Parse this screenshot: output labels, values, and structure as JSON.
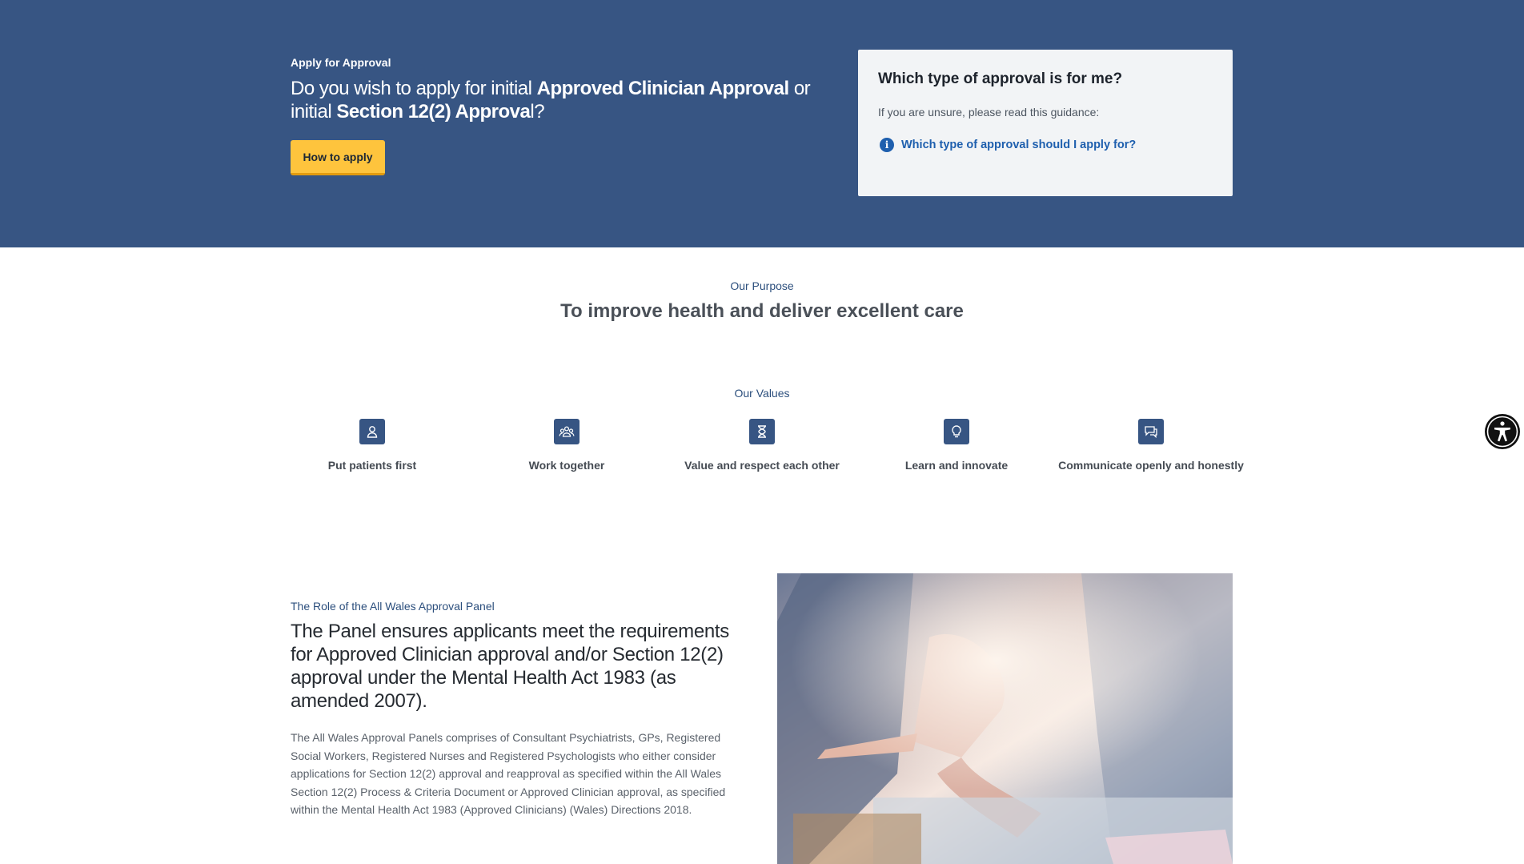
{
  "hero": {
    "eyebrow": "Apply for Approval",
    "title_part1": "Do you wish to apply for initial ",
    "title_bold1": "Approved Clinician Approval",
    "title_part2": " or initial ",
    "title_bold2": "Section 12(2) Approva",
    "title_part3": "l?",
    "button_label": "How to apply"
  },
  "approval_card": {
    "title": "Which type of approval is for me?",
    "text": "If you are unsure, please read this guidance:",
    "link_label": "Which type of approval should I apply for?"
  },
  "purpose": {
    "eyebrow": "Our Purpose",
    "title": "To improve health and deliver excellent care"
  },
  "values": {
    "eyebrow": "Our Values",
    "items": [
      {
        "label": "Put patients first",
        "icon": "person-icon"
      },
      {
        "label": "Work together",
        "icon": "group-icon"
      },
      {
        "label": "Value and respect each other",
        "icon": "hourglass-icon"
      },
      {
        "label": "Learn and innovate",
        "icon": "lightbulb-icon"
      },
      {
        "label": "Communicate openly and honestly",
        "icon": "chat-icon"
      }
    ]
  },
  "role": {
    "eyebrow": "The Role of the All Wales Approval Panel",
    "title": "The Panel ensures applicants meet the requirements for Approved Clinician approval and/or Section 12(2) approval under the Mental Health Act 1983 (as amended 2007).",
    "body": "The All Wales Approval Panels comprises of Consultant Psychiatrists, GPs, Registered Social Workers, Registered Nurses and Registered Psychologists who either consider applications for Section 12(2) approval and reapproval as specified within the All Wales Section 12(2) Process & Criteria Document or Approved Clinician approval, as specified within the Mental Health Act 1983 (Approved Clinicians) (Wales) Directions 2018."
  },
  "colors": {
    "hero_bg": "#375583",
    "button_bg": "#fec43d",
    "link": "#1e5fae",
    "eyebrow": "#2c4f7d"
  },
  "icons": {
    "info": "info-icon",
    "accessibility": "accessibility-icon"
  }
}
